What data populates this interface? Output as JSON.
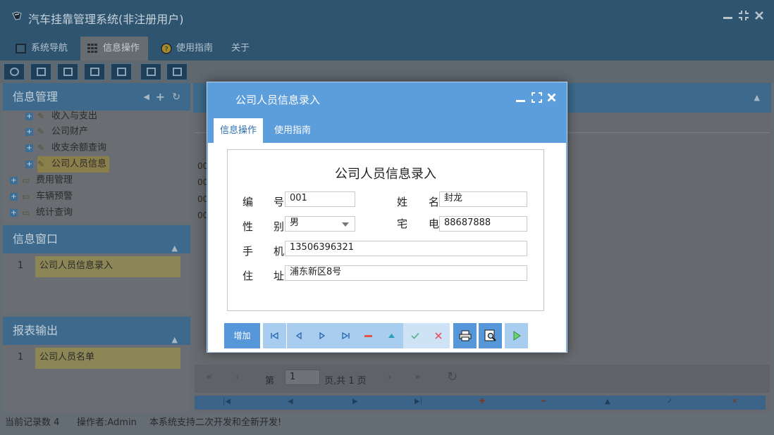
{
  "app": {
    "title": "汽车挂靠管理系统(非注册用户)",
    "window_controls": [
      "minimize",
      "restore",
      "close"
    ]
  },
  "menu": {
    "tabs": [
      {
        "label": "系统导航",
        "icon": "monitor-icon"
      },
      {
        "label": "信息操作",
        "icon": "grid-icon",
        "active": true
      },
      {
        "label": "使用指南",
        "icon": "help-circle-icon"
      },
      {
        "label": "关于"
      }
    ]
  },
  "sidebar": {
    "info_mgmt": {
      "title": "信息管理",
      "items": [
        {
          "label": "收入与支出",
          "icon": "tools-icon"
        },
        {
          "label": "公司财产",
          "icon": "tools-icon"
        },
        {
          "label": "收支余额查询",
          "icon": "tools-icon"
        },
        {
          "label": "公司人员信息",
          "icon": "tools-icon",
          "selected": true
        },
        {
          "label": "费用管理",
          "icon": "folder-icon"
        },
        {
          "label": "车辆预警",
          "icon": "folder-icon"
        },
        {
          "label": "统计查询",
          "icon": "folder-icon"
        }
      ]
    },
    "info_window": {
      "title": "信息窗口",
      "rows": [
        {
          "num": "1",
          "label": "公司人员信息录入"
        }
      ]
    },
    "report": {
      "title": "报表输出",
      "rows": [
        {
          "num": "1",
          "label": "公司人员名单"
        }
      ]
    }
  },
  "grid": {
    "codes": [
      "00",
      "00",
      "00",
      "00"
    ],
    "pager": {
      "page_prefix": "第",
      "page_value": "1",
      "page_suffix": "页,共 1 页"
    }
  },
  "status": {
    "record_count": "当前记录数 4",
    "operator": "操作者:Admin",
    "message": "本系统支持二次开发和全新开发!"
  },
  "dialog": {
    "title": "公司人员信息录入",
    "tabs": [
      {
        "label": "信息操作",
        "active": true
      },
      {
        "label": "使用指南"
      }
    ],
    "form": {
      "heading": "公司人员信息录入",
      "fields": {
        "id": {
          "label_a": "编",
          "label_b": "号",
          "value": "001"
        },
        "name": {
          "label_a": "姓",
          "label_b": "名",
          "value": "封龙"
        },
        "gender": {
          "label_a": "性",
          "label_b": "别",
          "value": "男"
        },
        "home_phone": {
          "label_a": "宅",
          "label_b": "电",
          "value": "88687888"
        },
        "mobile": {
          "label_a": "手",
          "label_b": "机",
          "value": "13506396321"
        },
        "address": {
          "label_a": "住",
          "label_b": "址",
          "value": "浦东新区8号"
        }
      }
    },
    "buttons": {
      "add": "增加"
    }
  }
}
